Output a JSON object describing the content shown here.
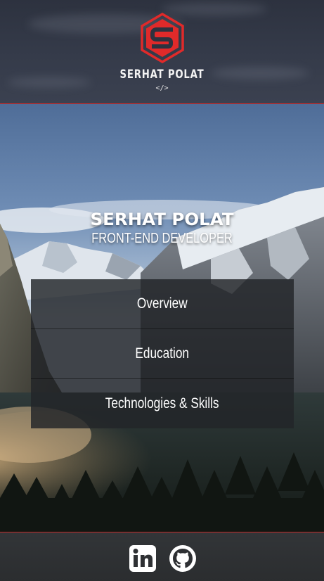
{
  "header": {
    "brand_name": "SERHAT POLAT",
    "brand_code": "</>",
    "logo_letter": "S"
  },
  "hero": {
    "title": "SERHAT POLAT",
    "subtitle": "FRONT-END DEVELOPER"
  },
  "menu": {
    "items": [
      {
        "label": "Overview"
      },
      {
        "label": "Education"
      },
      {
        "label": "Technologies & Skills"
      }
    ]
  },
  "footer": {
    "social": [
      {
        "icon": "linkedin-icon"
      },
      {
        "icon": "github-icon"
      }
    ]
  },
  "colors": {
    "accent": "#d12a2a",
    "header_bg": "#353b4a",
    "menu_bg": "#222428"
  }
}
